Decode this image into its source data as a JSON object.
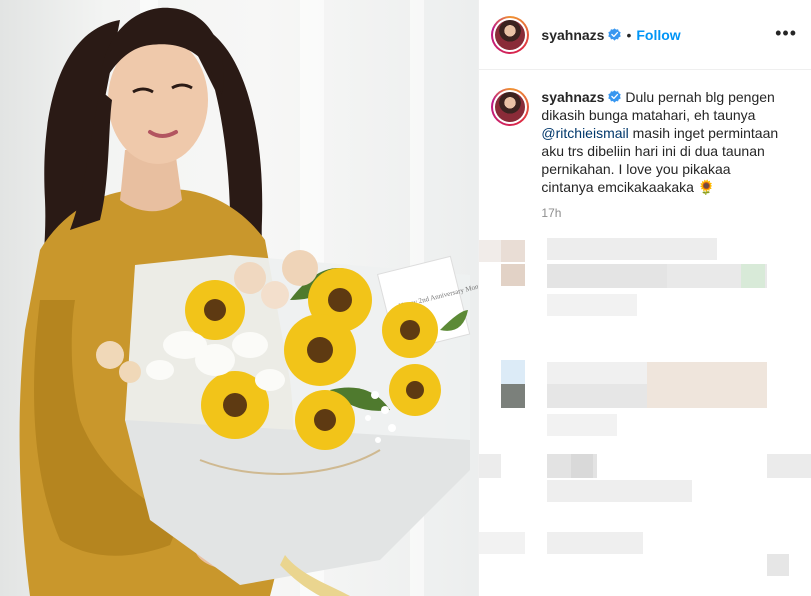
{
  "post": {
    "username": "syahnazs",
    "follow_label": "Follow",
    "separator": "•",
    "more_icon": "more-options-icon"
  },
  "caption": {
    "username": "syahnazs",
    "text_before": " Dulu pernah blg pengen dikasih bunga matahari, eh taunya ",
    "mention": "@ritchieismail",
    "text_after": " masih inget permintaan aku trs dibeliin hari ini di dua taunan pernikahan. I love you pikakaa cintanya emcikakaakaka ",
    "emoji": "🌻",
    "timestamp": "17h"
  },
  "photo": {
    "card_text": "Happy 2nd Anniversary Mommy",
    "card_brand": "BELLROSE"
  },
  "colors": {
    "accent": "#0095f6",
    "verified": "#3897f0",
    "text": "#262626",
    "muted": "#8e8e8e",
    "dress": "#c9972c"
  }
}
